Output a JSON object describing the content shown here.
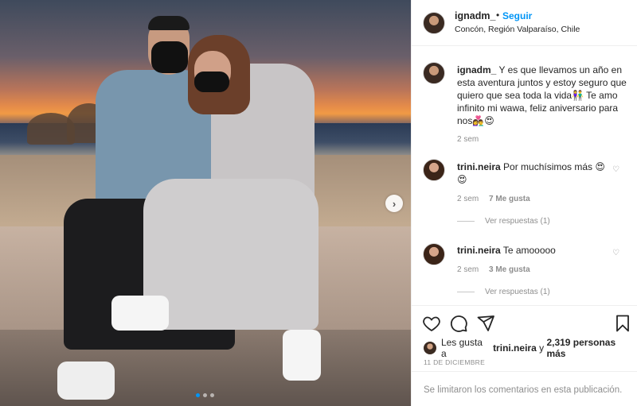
{
  "post": {
    "username": "ignadm_",
    "dot": "•",
    "follow_label": "Seguir",
    "location": "Concón, Región Valparaíso, Chile"
  },
  "caption": {
    "username": "ignadm_",
    "text": "Y es que llevamos un año en esta aventura juntos y estoy seguro que quiero que sea toda la vida👫 Te amo infinito mi wawa, feliz aniversario para nos👩‍❤️‍👨😍",
    "time": "2 sem"
  },
  "comments": [
    {
      "username": "trini.neira",
      "text": "Por muchísimos más 😍😍",
      "time": "2 sem",
      "likes": "7 Me gusta",
      "replies": "Ver respuestas (1)"
    },
    {
      "username": "trini.neira",
      "text": "Te amooooo",
      "time": "2 sem",
      "likes": "3 Me gusta",
      "replies": "Ver respuestas (1)"
    }
  ],
  "likes": {
    "prefix": "Les gusta a",
    "user": "trini.neira",
    "middle": "y",
    "count": "2,319 personas más"
  },
  "date": "11 DE DICIEMBRE",
  "footer": "Se limitaron los comentarios en esta publicación.",
  "carousel": {
    "next_icon": "chevron-right-icon",
    "slide_count": 3,
    "active_slide": 1
  },
  "colors": {
    "accent": "#0095f6",
    "muted": "#8e8e8e",
    "text": "#262626"
  }
}
